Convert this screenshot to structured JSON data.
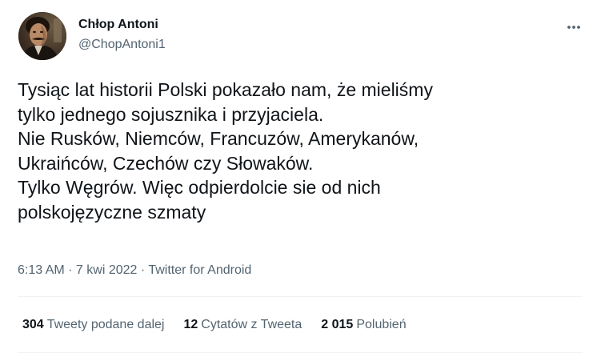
{
  "author": {
    "display_name": "Chłop Antoni",
    "handle": "@ChopAntoni1"
  },
  "more_icon": "more-horizontal-icon",
  "tweet": {
    "lines": [
      "Tysiąc lat historii Polski pokazało nam, że mieliśmy",
      "tylko jednego sojusznika i przyjaciela.",
      "Nie Rusków, Niemców, Francuzów, Amerykanów,",
      "Ukraińców, Czechów czy Słowaków.",
      "Tylko Węgrów. Więc odpierdolcie sie od nich",
      "polskojęzyczne szmaty"
    ]
  },
  "meta": {
    "time": "6:13 AM",
    "separator1": " · ",
    "date": "7 kwi 2022",
    "separator2": " · ",
    "source": "Twitter for Android"
  },
  "stats": {
    "retweets_count": "304",
    "retweets_label": "Tweety podane dalej",
    "quotes_count": "12",
    "quotes_label": "Cytatów z Tweeta",
    "likes_count": "2 015",
    "likes_label": "Polubień"
  },
  "colors": {
    "text_primary": "#0f1419",
    "text_secondary": "#536471",
    "divider": "#eff3f4"
  }
}
